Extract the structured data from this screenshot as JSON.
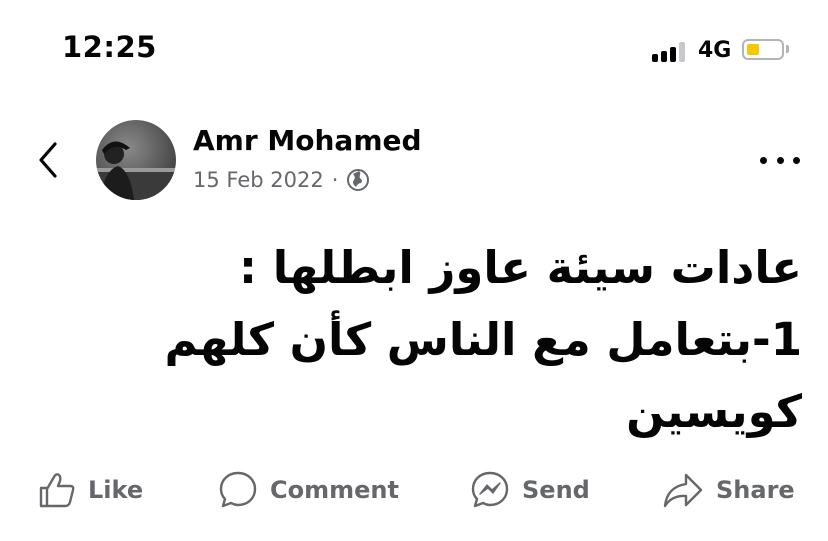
{
  "status_bar": {
    "time": "12:25",
    "network": "4G",
    "battery_level": 0.35,
    "battery_color": "#f6c800"
  },
  "header": {
    "back_icon": "chevron-left-icon",
    "author_name": "Amr Mohamed",
    "date": "15 Feb 2022",
    "separator": "·",
    "audience_icon": "globe-icon",
    "more_icon": "more-dots-icon"
  },
  "post": {
    "text": "عادات سيئة عاوز ابطلها :\n1-بتعامل مع الناس كأن كلهم كويسين"
  },
  "actions": {
    "like": "Like",
    "comment": "Comment",
    "send": "Send",
    "share": "Share"
  },
  "colors": {
    "text_primary": "#050505",
    "text_secondary": "#65676b"
  }
}
